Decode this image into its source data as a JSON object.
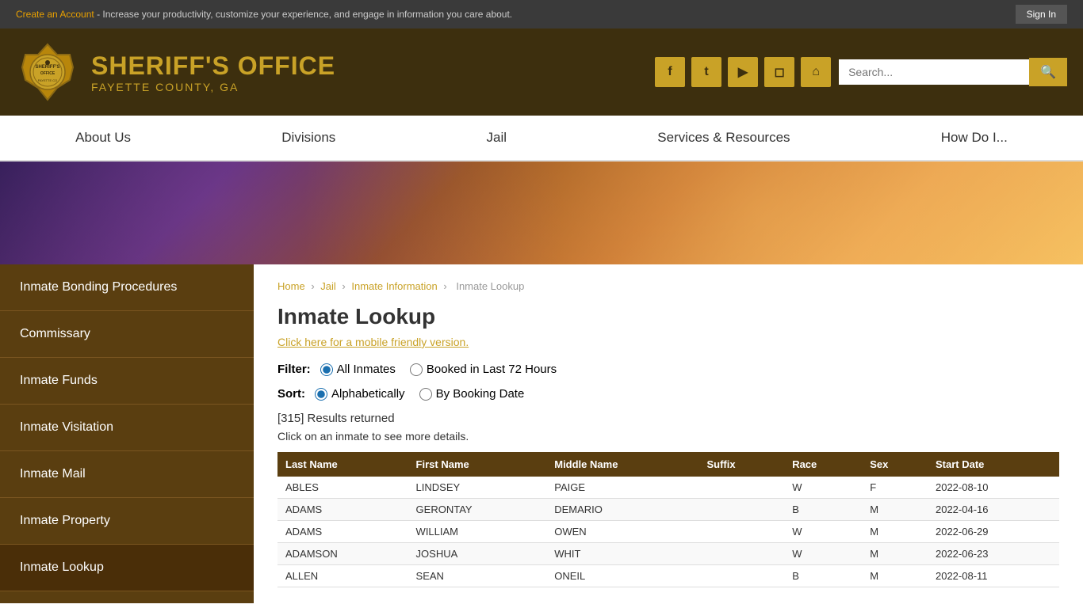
{
  "topbar": {
    "create_account_text": "Create an Account",
    "tagline": " - Increase your productivity, customize your experience, and engage in information you care about.",
    "sign_in_label": "Sign In"
  },
  "header": {
    "title": "SHERIFF'S OFFICE",
    "subtitle": "FAYETTE COUNTY, GA",
    "search_placeholder": "Search...",
    "social": [
      "f",
      "t",
      "▶",
      "📷",
      "🏠"
    ]
  },
  "nav": {
    "items": [
      "About Us",
      "Divisions",
      "Jail",
      "Services & Resources",
      "How Do I..."
    ]
  },
  "sidebar": {
    "items": [
      "Inmate Bonding Procedures",
      "Commissary",
      "Inmate Funds",
      "Inmate Visitation",
      "Inmate Mail",
      "Inmate Property",
      "Inmate Lookup"
    ]
  },
  "breadcrumb": {
    "home": "Home",
    "jail": "Jail",
    "inmate_info": "Inmate Information",
    "current": "Inmate Lookup"
  },
  "main": {
    "page_title": "Inmate Lookup",
    "mobile_link": "Click here for a mobile friendly version.",
    "filter_label": "Filter:",
    "filter_options": [
      "All Inmates",
      "Booked in Last 72 Hours"
    ],
    "sort_label": "Sort:",
    "sort_options": [
      "Alphabetically",
      "By Booking Date"
    ],
    "results_count": "[315] Results returned",
    "click_text": "Click on an inmate to see more details.",
    "table_headers": [
      "Last Name",
      "First Name",
      "Middle Name",
      "Suffix",
      "Race",
      "Sex",
      "Start Date"
    ],
    "table_rows": [
      [
        "ABLES",
        "LINDSEY",
        "PAIGE",
        "",
        "W",
        "F",
        "2022-08-10"
      ],
      [
        "ADAMS",
        "GERONTAY",
        "DEMARIO",
        "",
        "B",
        "M",
        "2022-04-16"
      ],
      [
        "ADAMS",
        "WILLIAM",
        "OWEN",
        "",
        "W",
        "M",
        "2022-06-29"
      ],
      [
        "ADAMSON",
        "JOSHUA",
        "WHIT",
        "",
        "W",
        "M",
        "2022-06-23"
      ],
      [
        "ALLEN",
        "SEAN",
        "ONEIL",
        "",
        "B",
        "M",
        "2022-08-11"
      ]
    ]
  },
  "icons": {
    "search": "🔍",
    "facebook": "f",
    "twitter": "t",
    "youtube": "▶",
    "instagram": "◻",
    "home": "⌂",
    "chevron": "›"
  }
}
